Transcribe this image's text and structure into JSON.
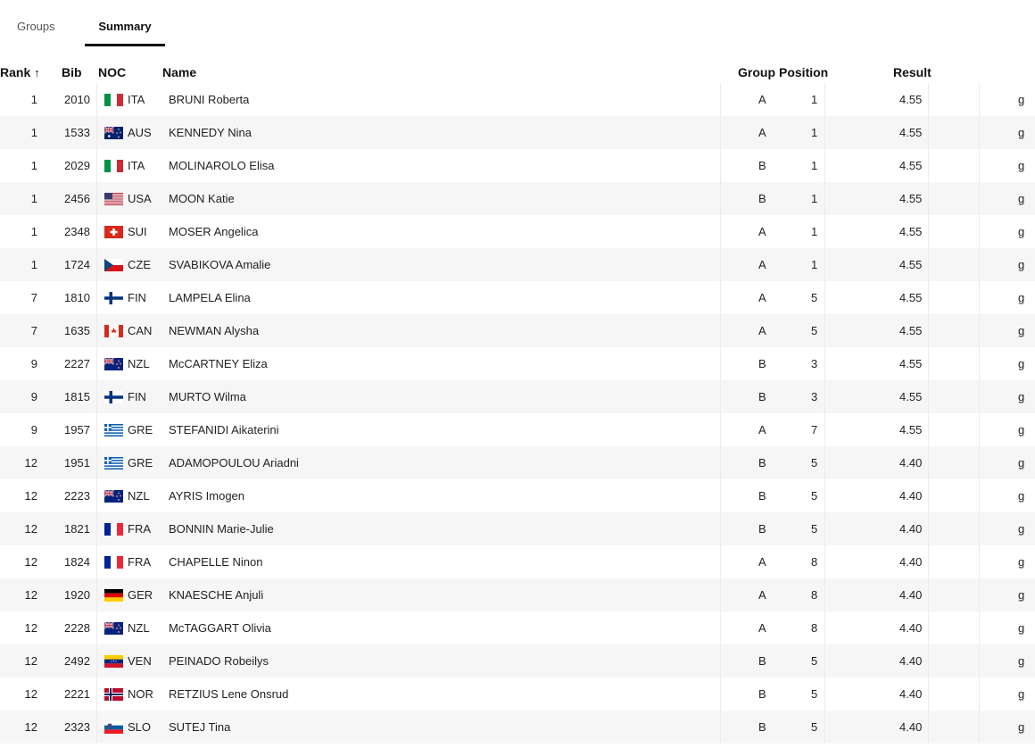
{
  "tabs": [
    {
      "label": "Groups",
      "active": false
    },
    {
      "label": "Summary",
      "active": true
    }
  ],
  "columns": {
    "rank": "Rank",
    "bib": "Bib",
    "noc": "NOC",
    "name": "Name",
    "group": "Group",
    "position": "Position",
    "result": "Result"
  },
  "sort_icon": "arrow-up-icon",
  "rows": [
    {
      "rank": "1",
      "bib": "2010",
      "noc": "ITA",
      "name": "BRUNI Roberta",
      "group": "A",
      "position": "1",
      "result": "4.55",
      "mark": "g"
    },
    {
      "rank": "1",
      "bib": "1533",
      "noc": "AUS",
      "name": "KENNEDY Nina",
      "group": "A",
      "position": "1",
      "result": "4.55",
      "mark": "g"
    },
    {
      "rank": "1",
      "bib": "2029",
      "noc": "ITA",
      "name": "MOLINAROLO Elisa",
      "group": "B",
      "position": "1",
      "result": "4.55",
      "mark": "g"
    },
    {
      "rank": "1",
      "bib": "2456",
      "noc": "USA",
      "name": "MOON Katie",
      "group": "B",
      "position": "1",
      "result": "4.55",
      "mark": "g"
    },
    {
      "rank": "1",
      "bib": "2348",
      "noc": "SUI",
      "name": "MOSER Angelica",
      "group": "A",
      "position": "1",
      "result": "4.55",
      "mark": "g"
    },
    {
      "rank": "1",
      "bib": "1724",
      "noc": "CZE",
      "name": "SVABIKOVA Amalie",
      "group": "A",
      "position": "1",
      "result": "4.55",
      "mark": "g"
    },
    {
      "rank": "7",
      "bib": "1810",
      "noc": "FIN",
      "name": "LAMPELA Elina",
      "group": "A",
      "position": "5",
      "result": "4.55",
      "mark": "g"
    },
    {
      "rank": "7",
      "bib": "1635",
      "noc": "CAN",
      "name": "NEWMAN Alysha",
      "group": "A",
      "position": "5",
      "result": "4.55",
      "mark": "g"
    },
    {
      "rank": "9",
      "bib": "2227",
      "noc": "NZL",
      "name": "McCARTNEY Eliza",
      "group": "B",
      "position": "3",
      "result": "4.55",
      "mark": "g"
    },
    {
      "rank": "9",
      "bib": "1815",
      "noc": "FIN",
      "name": "MURTO Wilma",
      "group": "B",
      "position": "3",
      "result": "4.55",
      "mark": "g"
    },
    {
      "rank": "9",
      "bib": "1957",
      "noc": "GRE",
      "name": "STEFANIDI Aikaterini",
      "group": "A",
      "position": "7",
      "result": "4.55",
      "mark": "g"
    },
    {
      "rank": "12",
      "bib": "1951",
      "noc": "GRE",
      "name": "ADAMOPOULOU Ariadni",
      "group": "B",
      "position": "5",
      "result": "4.40",
      "mark": "g"
    },
    {
      "rank": "12",
      "bib": "2223",
      "noc": "NZL",
      "name": "AYRIS Imogen",
      "group": "B",
      "position": "5",
      "result": "4.40",
      "mark": "g"
    },
    {
      "rank": "12",
      "bib": "1821",
      "noc": "FRA",
      "name": "BONNIN Marie-Julie",
      "group": "B",
      "position": "5",
      "result": "4.40",
      "mark": "g"
    },
    {
      "rank": "12",
      "bib": "1824",
      "noc": "FRA",
      "name": "CHAPELLE Ninon",
      "group": "A",
      "position": "8",
      "result": "4.40",
      "mark": "g"
    },
    {
      "rank": "12",
      "bib": "1920",
      "noc": "GER",
      "name": "KNAESCHE Anjuli",
      "group": "A",
      "position": "8",
      "result": "4.40",
      "mark": "g"
    },
    {
      "rank": "12",
      "bib": "2228",
      "noc": "NZL",
      "name": "McTAGGART Olivia",
      "group": "A",
      "position": "8",
      "result": "4.40",
      "mark": "g"
    },
    {
      "rank": "12",
      "bib": "2492",
      "noc": "VEN",
      "name": "PEINADO Robeilys",
      "group": "B",
      "position": "5",
      "result": "4.40",
      "mark": "g"
    },
    {
      "rank": "12",
      "bib": "2221",
      "noc": "NOR",
      "name": "RETZIUS Lene Onsrud",
      "group": "B",
      "position": "5",
      "result": "4.40",
      "mark": "g"
    },
    {
      "rank": "12",
      "bib": "2323",
      "noc": "SLO",
      "name": "SUTEJ Tina",
      "group": "B",
      "position": "5",
      "result": "4.40",
      "mark": "g"
    }
  ]
}
